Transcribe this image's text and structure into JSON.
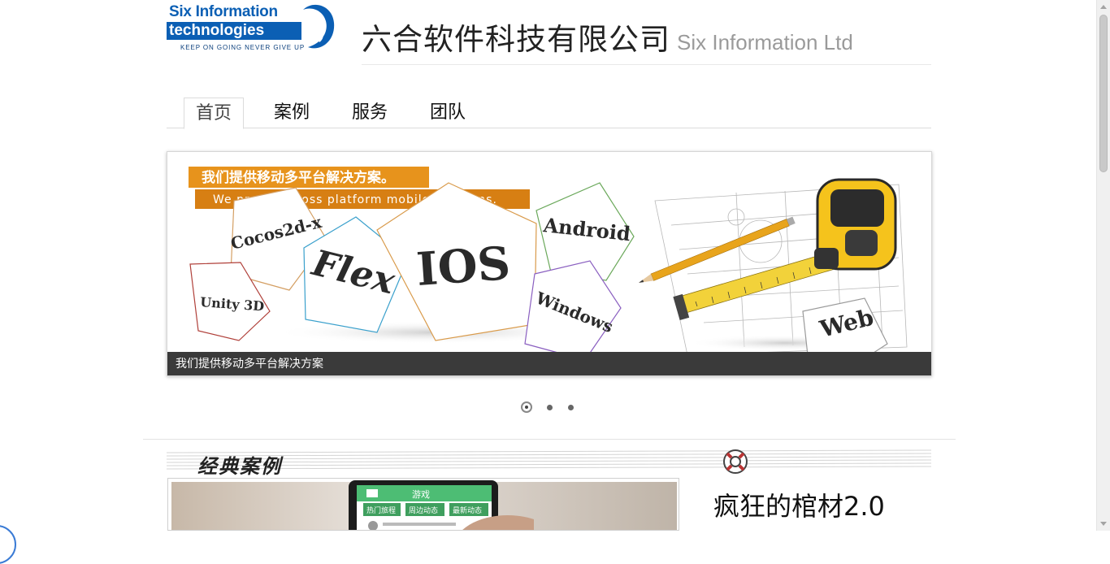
{
  "logo": {
    "line1": "Six Information",
    "line2": "technologies",
    "tagline": "KEEP ON GOING NEVER GIVE UP"
  },
  "company": {
    "name_cn": "六合软件科技有限公司",
    "name_en": "Six Information Ltd"
  },
  "nav": {
    "tabs": [
      {
        "label": "首页",
        "active": true
      },
      {
        "label": "案例",
        "active": false
      },
      {
        "label": "服务",
        "active": false
      },
      {
        "label": "团队",
        "active": false
      }
    ]
  },
  "banner": {
    "headline_cn": "我们提供移动多平台解决方案。",
    "headline_en": "We provide cross platform mobile solutions.",
    "platforms": [
      "Cocos2d-x",
      "Android",
      "Flex",
      "IOS",
      "Unity 3D",
      "Windows",
      "Web"
    ],
    "caption": "我们提供移动多平台解决方案",
    "slide_count": 3,
    "active_slide": 1
  },
  "section": {
    "title": "经典案例"
  },
  "case": {
    "title": "疯狂的棺材2.0",
    "app_header": "游戏",
    "app_tabs": [
      "热门旅程",
      "周边动态",
      "最新动态"
    ]
  },
  "colors": {
    "brand_blue": "#0b5fb4",
    "banner_orange": "#e7931c",
    "caption_bg": "#3a3a3a",
    "app_green": "#4dbd74"
  }
}
